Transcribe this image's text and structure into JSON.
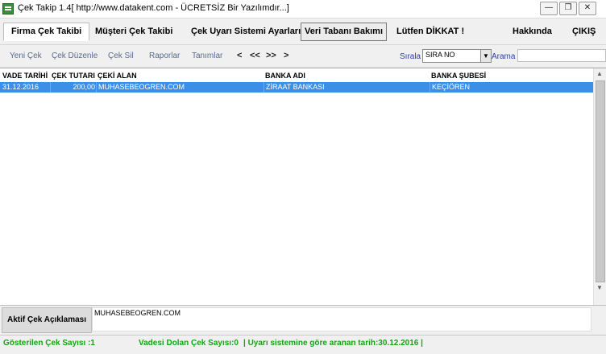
{
  "window": {
    "title": "Çek Takip 1.4[ http://www.datakent.com - ÜCRETSİZ Bir Yazılımdır...]",
    "minimize": "—",
    "restore": "❐",
    "close": "✕"
  },
  "menu": {
    "firma": "Firma Çek Takibi",
    "musteri": "Müşteri Çek Takibi",
    "uyari": "Çek Uyarı Sistemi Ayarları",
    "veritabani": "Veri Tabanı Bakımı",
    "dikkat": "Lütfen DİKKAT !",
    "hakkinda": "Hakkında",
    "cikis": "ÇIKIŞ"
  },
  "toolbar": {
    "yeni": "Yeni Çek",
    "duzenle": "Çek Düzenle",
    "sil": "Çek Sil",
    "raporlar": "Raporlar",
    "tanimlar": "Tanımlar",
    "nav_prev": "<",
    "nav_first": "<<",
    "nav_last": ">>",
    "nav_next": ">",
    "sort_label": "Sırala",
    "sort_value": "SIRA NO",
    "search_label": "Arama",
    "search_value": ""
  },
  "grid": {
    "headers": [
      "VADE TARİHİ",
      "ÇEK TUTARI",
      "ÇEKİ ALAN",
      "BANKA ADI",
      "BANKA ŞUBESİ"
    ],
    "rows": [
      [
        "31.12.2016",
        "200,00",
        "MUHASEBEOGREN.COM",
        "ZİRAAT BANKASI",
        "KEÇİÖREN"
      ]
    ]
  },
  "description": {
    "label": "Aktif Çek Açıklaması",
    "value": "MUHASEBEOGREN.COM"
  },
  "status": {
    "shown": "Gösterilen Çek Sayısı :1",
    "overdue": "Vadesi Dolan Çek Sayısı:0",
    "search_date": "| Uyarı sistemine göre aranan tarih:30.12.2016 |"
  },
  "colors": {
    "status_green": "#16a316",
    "selection_blue": "#3d8ee6",
    "toolbar_link": "#5a6b8c"
  }
}
